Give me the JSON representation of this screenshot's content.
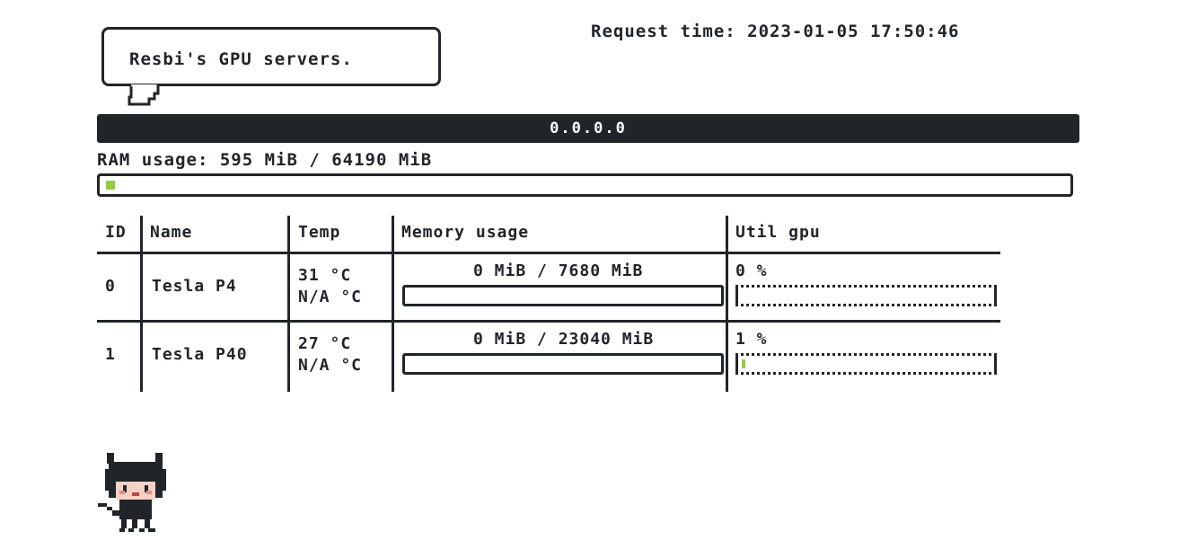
{
  "bubble": {
    "text": "Resbi's GPU servers."
  },
  "request_time": "Request time: 2023-01-05 17:50:46",
  "host": {
    "name": "0.0.0.0"
  },
  "ram": {
    "label": "RAM usage: 595 MiB / 64190 MiB",
    "used_mib": 595,
    "total_mib": 64190,
    "used_fraction": 0.0093
  },
  "table": {
    "headers": {
      "id": "ID",
      "name": "Name",
      "temp": "Temp",
      "memory": "Memory usage",
      "util": "Util gpu"
    },
    "rows": [
      {
        "id": "0",
        "name": "Tesla P4",
        "temp": "31 °C",
        "temp2": "N/A °C",
        "memory": "0 MiB /  7680 MiB",
        "mem_fraction": 0.0,
        "util": "0 %",
        "util_fraction": 0.0
      },
      {
        "id": "1",
        "name": "Tesla P40",
        "temp": "27 °C",
        "temp2": "N/A °C",
        "memory": "0 MiB / 23040 MiB",
        "mem_fraction": 0.0,
        "util": "1 %",
        "util_fraction": 0.01
      }
    ]
  },
  "colors": {
    "accent_green": "#92cc41",
    "dark": "#212529",
    "background": "#ffffff"
  },
  "icons": {
    "mascot": "octocat-icon",
    "bubble_tail": "speech-bubble-tail-icon"
  }
}
